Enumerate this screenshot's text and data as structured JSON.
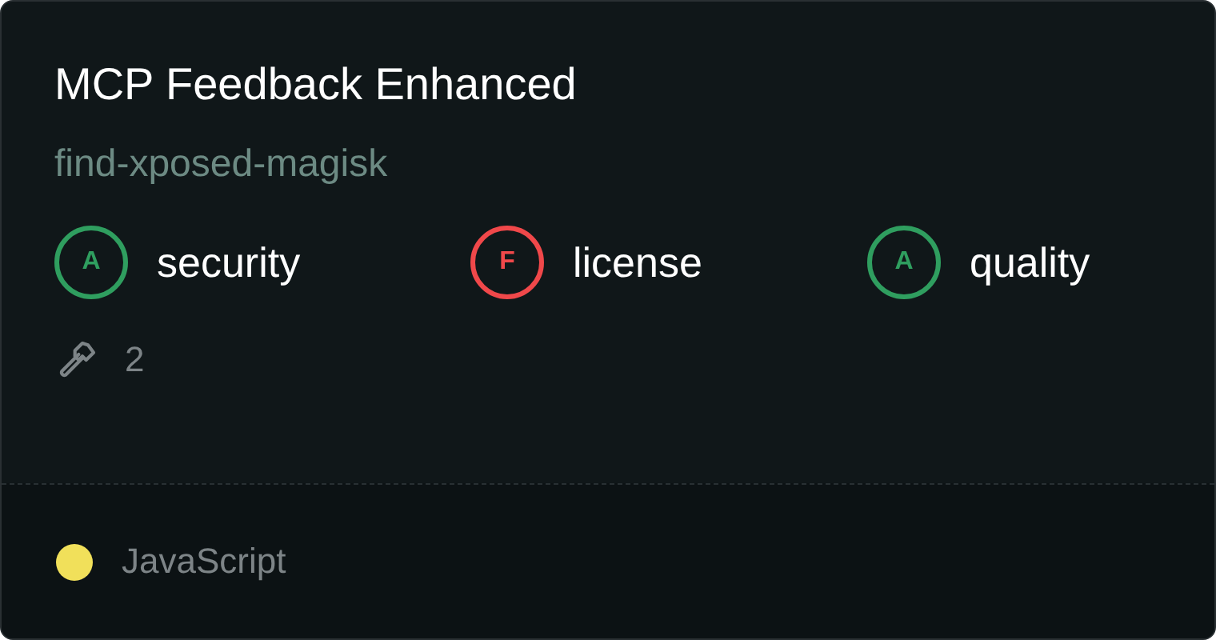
{
  "title": "MCP Feedback Enhanced",
  "subtitle": "find-xposed-magisk",
  "grades": [
    {
      "grade": "A",
      "label": "security",
      "color": "#2f9e5f"
    },
    {
      "grade": "F",
      "label": "license",
      "color": "#f0484a"
    },
    {
      "grade": "A",
      "label": "quality",
      "color": "#2f9e5f"
    }
  ],
  "tools_count": "2",
  "language": {
    "name": "JavaScript",
    "color": "#f1e05a"
  }
}
